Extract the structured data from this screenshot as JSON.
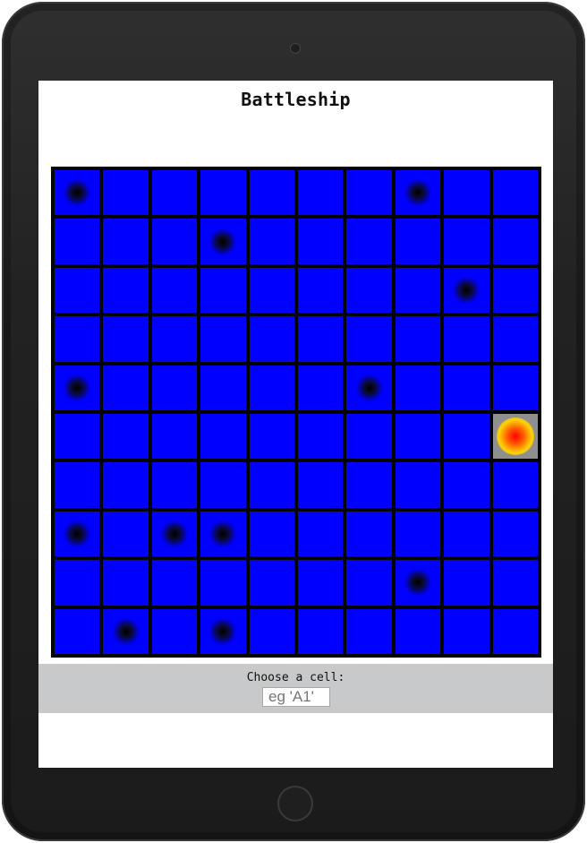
{
  "title": "Battleship",
  "control": {
    "label": "Choose a cell:",
    "input_placeholder": "eg 'A1'",
    "input_value": ""
  },
  "board": {
    "columns": 10,
    "rows": 10,
    "states": [
      [
        "miss",
        "",
        "",
        "",
        "",
        "",
        "",
        "miss",
        "",
        ""
      ],
      [
        "",
        "",
        "",
        "miss",
        "",
        "",
        "",
        "",
        "",
        ""
      ],
      [
        "",
        "",
        "",
        "",
        "",
        "",
        "",
        "",
        "miss",
        ""
      ],
      [
        "",
        "",
        "",
        "",
        "",
        "",
        "",
        "",
        "",
        ""
      ],
      [
        "miss",
        "",
        "",
        "",
        "",
        "",
        "miss",
        "",
        "",
        ""
      ],
      [
        "",
        "",
        "",
        "",
        "",
        "",
        "",
        "",
        "",
        "hit"
      ],
      [
        "",
        "",
        "",
        "",
        "",
        "",
        "",
        "",
        "",
        ""
      ],
      [
        "miss",
        "",
        "miss",
        "miss",
        "",
        "",
        "",
        "",
        "",
        ""
      ],
      [
        "",
        "",
        "",
        "",
        "",
        "",
        "",
        "miss",
        "",
        ""
      ],
      [
        "",
        "miss",
        "",
        "miss",
        "",
        "",
        "",
        "",
        "",
        ""
      ]
    ]
  },
  "colors": {
    "water": "#0000ff",
    "miss_marker": "#000000",
    "hit_background": "#8f8f8f",
    "hit_marker_core": "#ff0000",
    "hit_marker_ring": "#ffd200",
    "control_bar": "#c8c9ca"
  },
  "icons": {
    "camera": "camera-dot",
    "home": "home-button-ring"
  }
}
